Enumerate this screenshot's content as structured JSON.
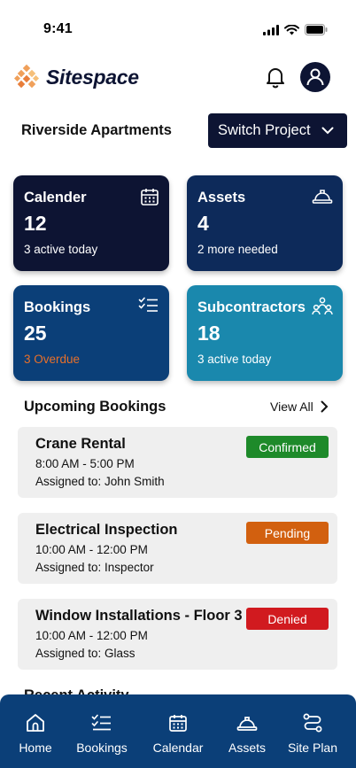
{
  "status": {
    "time": "9:41"
  },
  "header": {
    "app_name": "Sitespace"
  },
  "project": {
    "name": "Riverside Apartments",
    "switch_label": "Switch Project"
  },
  "cards": [
    {
      "title": "Calender",
      "value": "12",
      "sub": "3 active today",
      "icon": "calendar-icon"
    },
    {
      "title": "Assets",
      "value": "4",
      "sub": "2 more needed",
      "icon": "hard-hat-icon"
    },
    {
      "title": "Bookings",
      "value": "25",
      "sub": "3 Overdue",
      "icon": "checklist-icon"
    },
    {
      "title": "Subcontractors",
      "value": "18",
      "sub": "3 active today",
      "icon": "people-icon"
    }
  ],
  "upcoming": {
    "title": "Upcoming Bookings",
    "view_all": "View All",
    "items": [
      {
        "title": "Crane Rental",
        "time": "8:00 AM - 5:00 PM",
        "assigned": "Assigned to: John Smith",
        "status": "Confirmed",
        "status_color": "#1e8a2a"
      },
      {
        "title": "Electrical Inspection",
        "time": "10:00 AM - 12:00 PM",
        "assigned": "Assigned to: Inspector",
        "status": "Pending",
        "status_color": "#d2600f"
      },
      {
        "title": "Window Installations - Floor 3",
        "time": "10:00 AM - 12:00 PM",
        "assigned": "Assigned to: Glass",
        "status": "Denied",
        "status_color": "#d11a1f"
      }
    ]
  },
  "recent": {
    "title": "Recent Activity"
  },
  "tabs": [
    {
      "label": "Home",
      "icon": "home-icon"
    },
    {
      "label": "Bookings",
      "icon": "checklist-icon"
    },
    {
      "label": "Calendar",
      "icon": "calendar-icon"
    },
    {
      "label": "Assets",
      "icon": "hard-hat-icon"
    },
    {
      "label": "Site Plan",
      "icon": "route-icon"
    }
  ],
  "colors": {
    "navy": "#0d1433",
    "tab_bar": "#0b3f78",
    "teal": "#1a88ad",
    "overdue": "#e8702a",
    "logo_orange": "#f0a05a"
  }
}
